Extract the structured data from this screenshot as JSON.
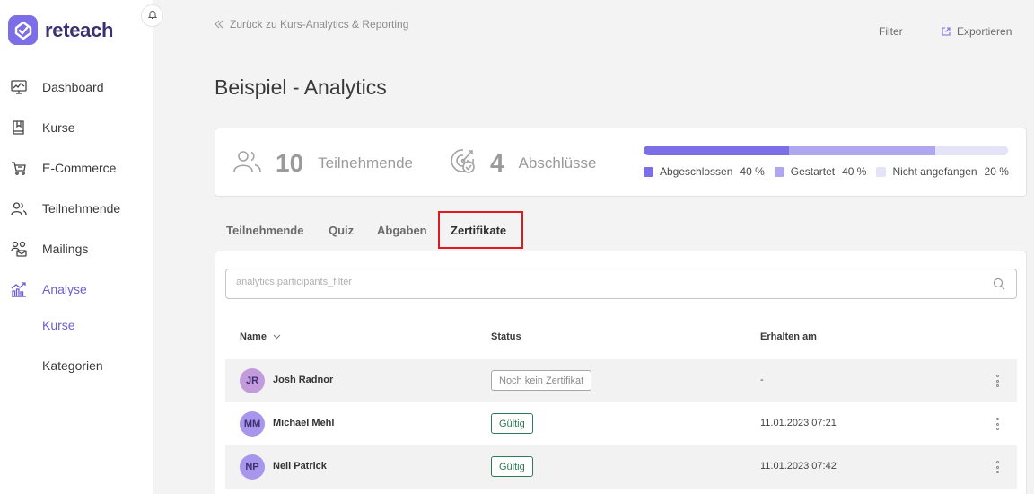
{
  "brand": {
    "name": "reteach",
    "color": "#7c6ee6"
  },
  "sidebar": {
    "items": [
      {
        "label": "Dashboard",
        "icon": "dashboard-icon"
      },
      {
        "label": "Kurse",
        "icon": "book-icon"
      },
      {
        "label": "E-Commerce",
        "icon": "cart-icon"
      },
      {
        "label": "Teilnehmende",
        "icon": "users-icon"
      },
      {
        "label": "Mailings",
        "icon": "mailings-icon"
      },
      {
        "label": "Analyse",
        "icon": "analytics-icon"
      }
    ],
    "sub_items": [
      {
        "label": "Kurse"
      },
      {
        "label": "Kategorien"
      }
    ]
  },
  "header": {
    "back_label": "Zurück zu Kurs-Analytics & Reporting",
    "filter_label": "Filter",
    "export_label": "Exportieren",
    "title": "Beispiel - Analytics"
  },
  "stats": {
    "participants": {
      "value": "10",
      "label": "Teilnehmende"
    },
    "completions": {
      "value": "4",
      "label": "Abschlüsse"
    },
    "progress": [
      {
        "label": "Abgeschlossen",
        "percent_label": "40 %",
        "value": 40,
        "color": "#7c6ee6"
      },
      {
        "label": "Gestartet",
        "percent_label": "40 %",
        "value": 40,
        "color": "#aea6ee"
      },
      {
        "label": "Nicht angefangen",
        "percent_label": "20 %",
        "value": 20,
        "color": "#e5e3f8"
      }
    ]
  },
  "tabs": [
    {
      "label": "Teilnehmende"
    },
    {
      "label": "Quiz"
    },
    {
      "label": "Abgaben"
    },
    {
      "label": "Zertifikate",
      "active": true
    }
  ],
  "table": {
    "search_placeholder": "analytics.participants_filter",
    "columns": {
      "name": "Name",
      "status": "Status",
      "date": "Erhalten am"
    },
    "rows": [
      {
        "initials": "JR",
        "name": "Josh Radnor",
        "status": "Noch kein Zertifikat",
        "status_kind": "none",
        "date": "-",
        "avatar_color": "#c39bdc"
      },
      {
        "initials": "MM",
        "name": "Michael Mehl",
        "status": "Gültig",
        "status_kind": "ok",
        "date": "11.01.2023 07:21",
        "avatar_color": "#a796ec"
      },
      {
        "initials": "NP",
        "name": "Neil Patrick",
        "status": "Gültig",
        "status_kind": "ok",
        "date": "11.01.2023 07:42",
        "avatar_color": "#a796ec"
      }
    ]
  }
}
